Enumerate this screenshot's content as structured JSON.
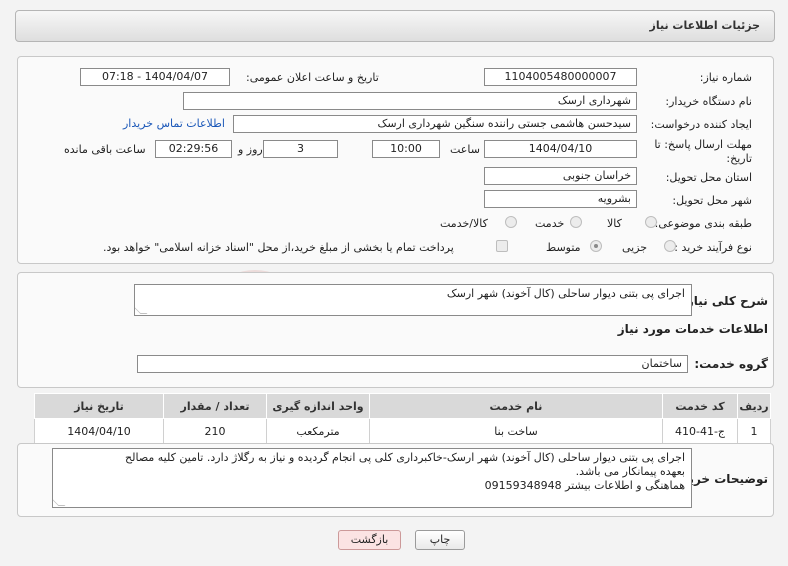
{
  "panel_title": "جزئیات اطلاعات نیاز",
  "fields": {
    "need_number_label": "شماره نیاز:",
    "need_number": "1104005480000007",
    "announce_label": "تاریخ و ساعت اعلان عمومی:",
    "announce_value": "1404/04/07 - 07:18",
    "buyer_label": "نام دستگاه خریدار:",
    "buyer_value": "شهرداری ارسک",
    "creator_label": "ایجاد کننده درخواست:",
    "creator_value": "سیدحسن هاشمی جستی راننده سنگین شهرداری ارسک",
    "contact_link": "اطلاعات تماس خریدار",
    "deadline_label_1": "مهلت ارسال پاسخ: تا",
    "deadline_label_2": "تاریخ:",
    "deadline_date": "1404/04/10",
    "time_label": "ساعت",
    "deadline_time": "10:00",
    "days_value": "3",
    "days_label": "روز و",
    "remaining_time": "02:29:56",
    "remaining_label": "ساعت باقی مانده",
    "province_label": "استان محل تحویل:",
    "province_value": "خراسان جنوبی",
    "city_label": "شهر محل تحویل:",
    "city_value": "بشرویه",
    "category_label": "طبقه بندی موضوعی:",
    "category_options": [
      "کالا",
      "خدمت",
      "کالا/خدمت"
    ],
    "process_label": "نوع فرآیند خرید :",
    "process_options": [
      "جزیی",
      "متوسط"
    ],
    "payment_note": "پرداخت تمام یا بخشی از مبلغ خرید،از محل \"اسناد خزانه اسلامی\" خواهد بود."
  },
  "summary": {
    "label": "شرح کلی نیاز:",
    "value": "اجرای پی بتنی دیوار ساحلی (کال آخوند) شهر ارسک"
  },
  "services": {
    "section_title": "اطلاعات خدمات مورد نیاز",
    "group_label": "گروه خدمت:",
    "group_value": "ساختمان",
    "columns": [
      "ردیف",
      "کد خدمت",
      "نام خدمت",
      "واحد اندازه گیری",
      "تعداد / مقدار",
      "تاریخ نیاز"
    ],
    "rows": [
      [
        "1",
        "ج-41-410",
        "ساخت بنا",
        "مترمکعب",
        "210",
        "1404/04/10"
      ]
    ]
  },
  "notes": {
    "label": "توضیحات خریدار:",
    "line1": "اجرای پی بتنی دیوار ساحلی (کال آخوند) شهر ارسک-خاکبرداری کلی پی انجام گردیده و نیاز به رگلاژ دارد. تامین کلیه مصالح",
    "line2": "بعهده پیمانکار می باشد.",
    "line3": "هماهنگی و اطلاعات بیشتر 09159348948"
  },
  "buttons": {
    "print": "چاپ",
    "back": "بازگشت"
  },
  "watermark": "AriaTender.neT",
  "colors": {
    "link": "#1a57b8",
    "back_button_bg": "#fbe3e3",
    "watermark": "#c0392b"
  }
}
